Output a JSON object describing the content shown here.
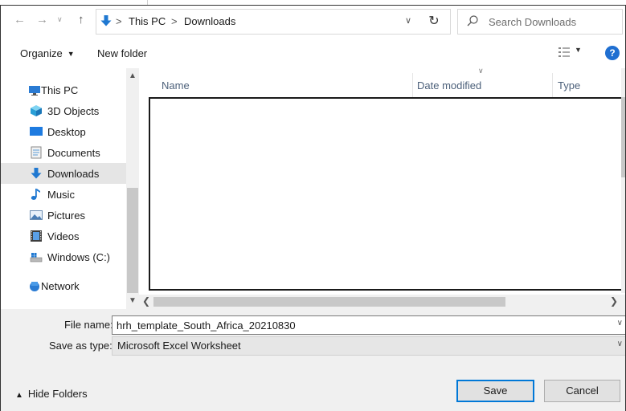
{
  "address_bar": {
    "crumbs": [
      "This PC",
      "Downloads"
    ],
    "separator": ">"
  },
  "search": {
    "placeholder": "Search Downloads"
  },
  "toolbar": {
    "organize_label": "Organize",
    "new_folder_label": "New folder",
    "help_label": "?"
  },
  "nav_pane": {
    "items": [
      {
        "label": "This PC",
        "icon": "computer-icon"
      },
      {
        "label": "3D Objects",
        "icon": "cube-icon"
      },
      {
        "label": "Desktop",
        "icon": "desktop-icon"
      },
      {
        "label": "Documents",
        "icon": "document-icon"
      },
      {
        "label": "Downloads",
        "icon": "download-arrow-icon",
        "selected": true
      },
      {
        "label": "Music",
        "icon": "music-note-icon"
      },
      {
        "label": "Pictures",
        "icon": "pictures-icon"
      },
      {
        "label": "Videos",
        "icon": "film-icon"
      },
      {
        "label": "Windows (C:)",
        "icon": "drive-icon"
      },
      {
        "label": "Network",
        "icon": "network-icon"
      }
    ]
  },
  "file_list": {
    "columns": [
      "Name",
      "Date modified",
      "Type"
    ]
  },
  "form": {
    "file_name_label": "File name:",
    "file_name_value": "hrh_template_South_Africa_20210830",
    "save_as_type_label": "Save as type:",
    "save_as_type_value": "Microsoft Excel Worksheet"
  },
  "footer": {
    "hide_folders_label": "Hide Folders",
    "save_label": "Save",
    "cancel_label": "Cancel"
  },
  "colors": {
    "accent": "#0078d7",
    "selected_bg": "#e5e5e5",
    "form_bg": "#f0f0f0"
  }
}
